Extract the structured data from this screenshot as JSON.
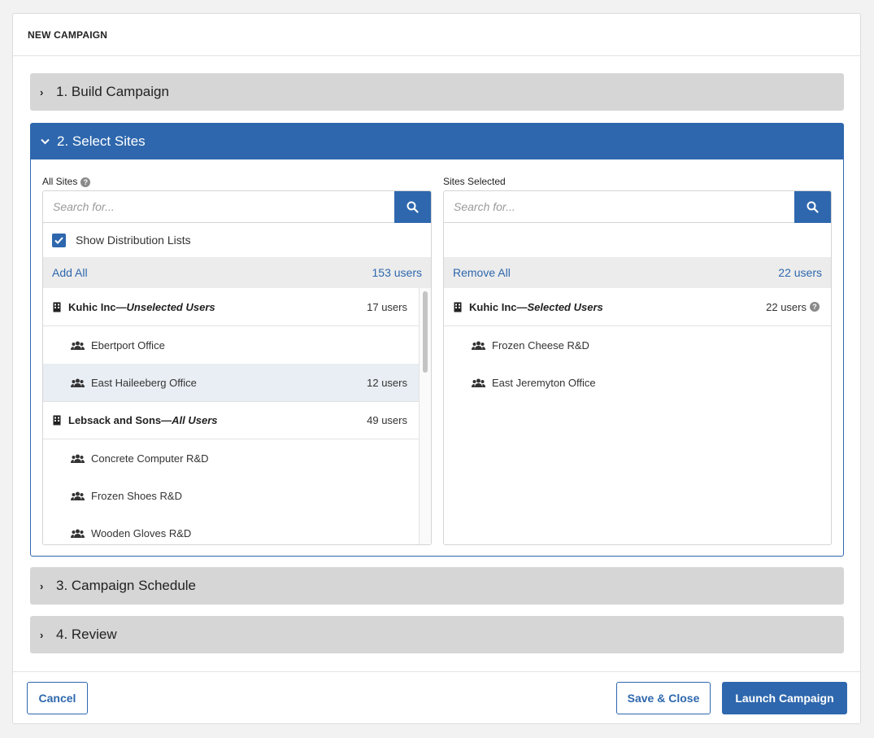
{
  "header": {
    "title": "NEW CAMPAIGN"
  },
  "steps": {
    "build": "1. Build Campaign",
    "select_sites": "2. Select Sites",
    "schedule": "3. Campaign Schedule",
    "review": "4. Review"
  },
  "all_sites": {
    "label": "All Sites",
    "search_placeholder": "Search for...",
    "show_distribution_lists": "Show Distribution Lists",
    "add_all": "Add All",
    "total": "153 users",
    "groups": [
      {
        "company": "Kuhic Inc",
        "dash": " — ",
        "qualifier": "Unselected Users",
        "count": "17 users",
        "items": [
          {
            "name": "Ebertport Office",
            "count": ""
          },
          {
            "name": "East Haileeberg Office",
            "count": "12 users"
          }
        ]
      },
      {
        "company": "Lebsack and Sons",
        "dash": " — ",
        "qualifier": "All Users",
        "count": "49 users",
        "items": [
          {
            "name": "Concrete Computer R&D",
            "count": ""
          },
          {
            "name": "Frozen Shoes R&D",
            "count": ""
          },
          {
            "name": "Wooden Gloves R&D",
            "count": ""
          }
        ]
      }
    ]
  },
  "selected_sites": {
    "label": "Sites Selected",
    "search_placeholder": "Search for...",
    "remove_all": "Remove All",
    "total": "22 users",
    "group": {
      "company": "Kuhic Inc",
      "dash": " — ",
      "qualifier": "Selected Users",
      "count": "22 users",
      "items": [
        {
          "name": "Frozen Cheese R&D"
        },
        {
          "name": "East Jeremyton Office"
        }
      ]
    }
  },
  "footer": {
    "cancel": "Cancel",
    "save_close": "Save & Close",
    "launch": "Launch Campaign"
  },
  "colors": {
    "primary": "#2e67ad",
    "step_bg": "#d6d6d6",
    "highlight": "#e9eef4"
  }
}
